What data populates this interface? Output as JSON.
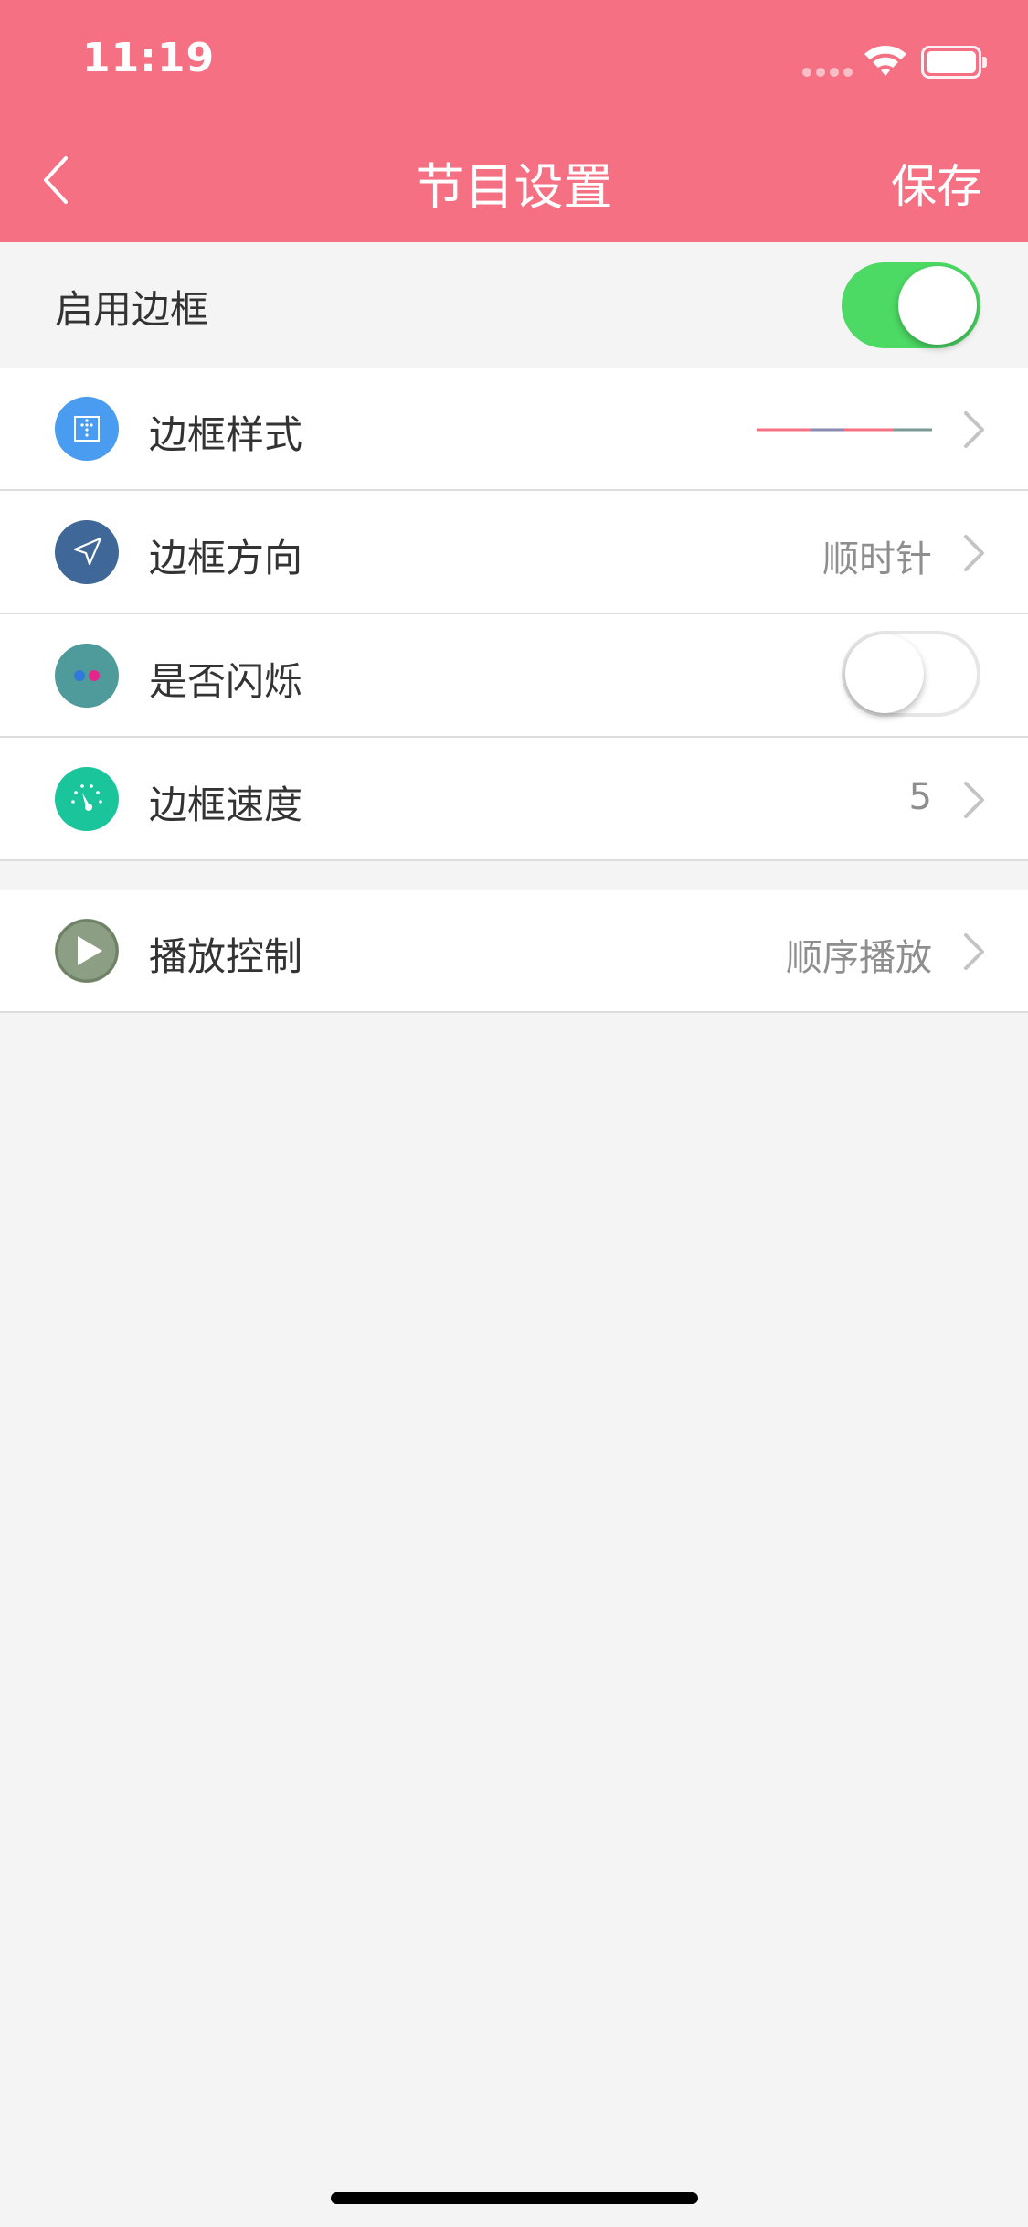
{
  "status_bar": {
    "time": "11:19"
  },
  "nav": {
    "title": "节目设置",
    "save_label": "保存"
  },
  "enable_border": {
    "label": "启用边框",
    "on": true
  },
  "settings": {
    "rows": [
      {
        "label": "边框样式",
        "value": "",
        "icon": "border-style-icon",
        "icon_color": "#4a9cf0"
      },
      {
        "label": "边框方向",
        "value": "顺时针",
        "icon": "direction-arrow-icon",
        "icon_color": "#3f6797"
      },
      {
        "label": "是否闪烁",
        "value": "",
        "icon": "blink-dots-icon",
        "icon_color": "#4f9a9b",
        "toggle_on": false
      },
      {
        "label": "边框速度",
        "value": "5",
        "icon": "speedometer-icon",
        "icon_color": "#1bc59b"
      }
    ]
  },
  "playback": {
    "label": "播放控制",
    "value": "顺序播放",
    "icon": "play-icon",
    "icon_color": "#8c9e83"
  },
  "colors": {
    "header": "#f47082",
    "toggle_on": "#4cd964",
    "background": "#f4f4f4"
  }
}
